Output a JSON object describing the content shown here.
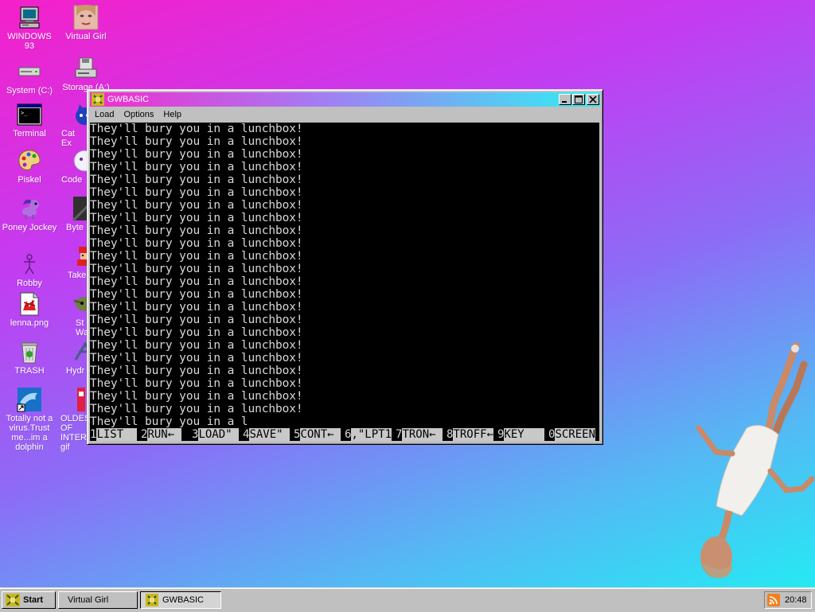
{
  "desktop": {
    "icons": [
      {
        "label": "WINDOWS 93",
        "icon": "computer-icon"
      },
      {
        "label": "Virtual Girl",
        "icon": "girl-face-icon"
      },
      {
        "label": "System (C:)",
        "icon": "hard-drive-icon"
      },
      {
        "label": "Storage (A:)",
        "icon": "floppy-drive-icon"
      },
      {
        "label": "Terminal",
        "icon": "terminal-icon"
      },
      {
        "label": "Cat Ex",
        "icon": "cat-explorer-icon"
      },
      {
        "label": "Piskel",
        "icon": "palette-icon"
      },
      {
        "label": "Code",
        "icon": "code-icon"
      },
      {
        "label": "Poney Jockey",
        "icon": "pony-icon"
      },
      {
        "label": "Byte",
        "icon": "byte-icon"
      },
      {
        "label": "Robby",
        "icon": "stick-figure-icon"
      },
      {
        "label": "Take",
        "icon": "pixel-character-icon"
      },
      {
        "label": "lenna.png",
        "icon": "image-file-icon"
      },
      {
        "label": "St\nWar",
        "icon": "star-wars-icon"
      },
      {
        "label": "TRASH",
        "icon": "trash-icon"
      },
      {
        "label": "Hydr",
        "icon": "hydra-icon"
      },
      {
        "label": "Totally not a virus.Trust me...im a dolphin",
        "icon": "dolphin-icon"
      },
      {
        "label": "OLDES\nOF\nINTER\ngif",
        "icon": "gif-file-icon"
      }
    ]
  },
  "window": {
    "title": "GWBASIC",
    "menu": [
      "Load",
      "Options",
      "Help"
    ],
    "console_lines": [
      "They'll bury you in a lunchbox!",
      "They'll bury you in a lunchbox!",
      "They'll bury you in a lunchbox!",
      "They'll bury you in a lunchbox!",
      "They'll bury you in a lunchbox!",
      "They'll bury you in a lunchbox!",
      "They'll bury you in a lunchbox!",
      "They'll bury you in a lunchbox!",
      "They'll bury you in a lunchbox!",
      "They'll bury you in a lunchbox!",
      "They'll bury you in a lunchbox!",
      "They'll bury you in a lunchbox!",
      "They'll bury you in a lunchbox!",
      "They'll bury you in a lunchbox!",
      "They'll bury you in a lunchbox!",
      "They'll bury you in a lunchbox!",
      "They'll bury you in a lunchbox!",
      "They'll bury you in a lunchbox!",
      "They'll bury you in a lunchbox!",
      "They'll bury you in a lunchbox!",
      "They'll bury you in a lunchbox!",
      "They'll bury you in a lunchbox!",
      "They'll bury you in a lunchbox!",
      "They'll bury you in a l"
    ],
    "function_keys": [
      {
        "num": "1",
        "text": "LIST  "
      },
      {
        "num": "2",
        "text": "RUN← "
      },
      {
        "num": "3",
        "text": "LOAD\" "
      },
      {
        "num": "4",
        "text": "SAVE\" "
      },
      {
        "num": "5",
        "text": "CONT← "
      },
      {
        "num": "6",
        "text": ",\"LPT1"
      },
      {
        "num": "7",
        "text": "TRON← "
      },
      {
        "num": "8",
        "text": "TROFF←"
      },
      {
        "num": "9",
        "text": "KEY   "
      },
      {
        "num": "0",
        "text": "SCREEN"
      }
    ]
  },
  "taskbar": {
    "start_label": "Start",
    "tasks": [
      {
        "label": "Virtual Girl",
        "active": false
      },
      {
        "label": "GWBASIC",
        "active": true
      }
    ],
    "clock": "20:48",
    "tray_icon": "rss-icon"
  },
  "colors": {
    "console_bg": "#000000",
    "console_fg": "#d8d8d8",
    "window_face": "#c0c0c0"
  }
}
